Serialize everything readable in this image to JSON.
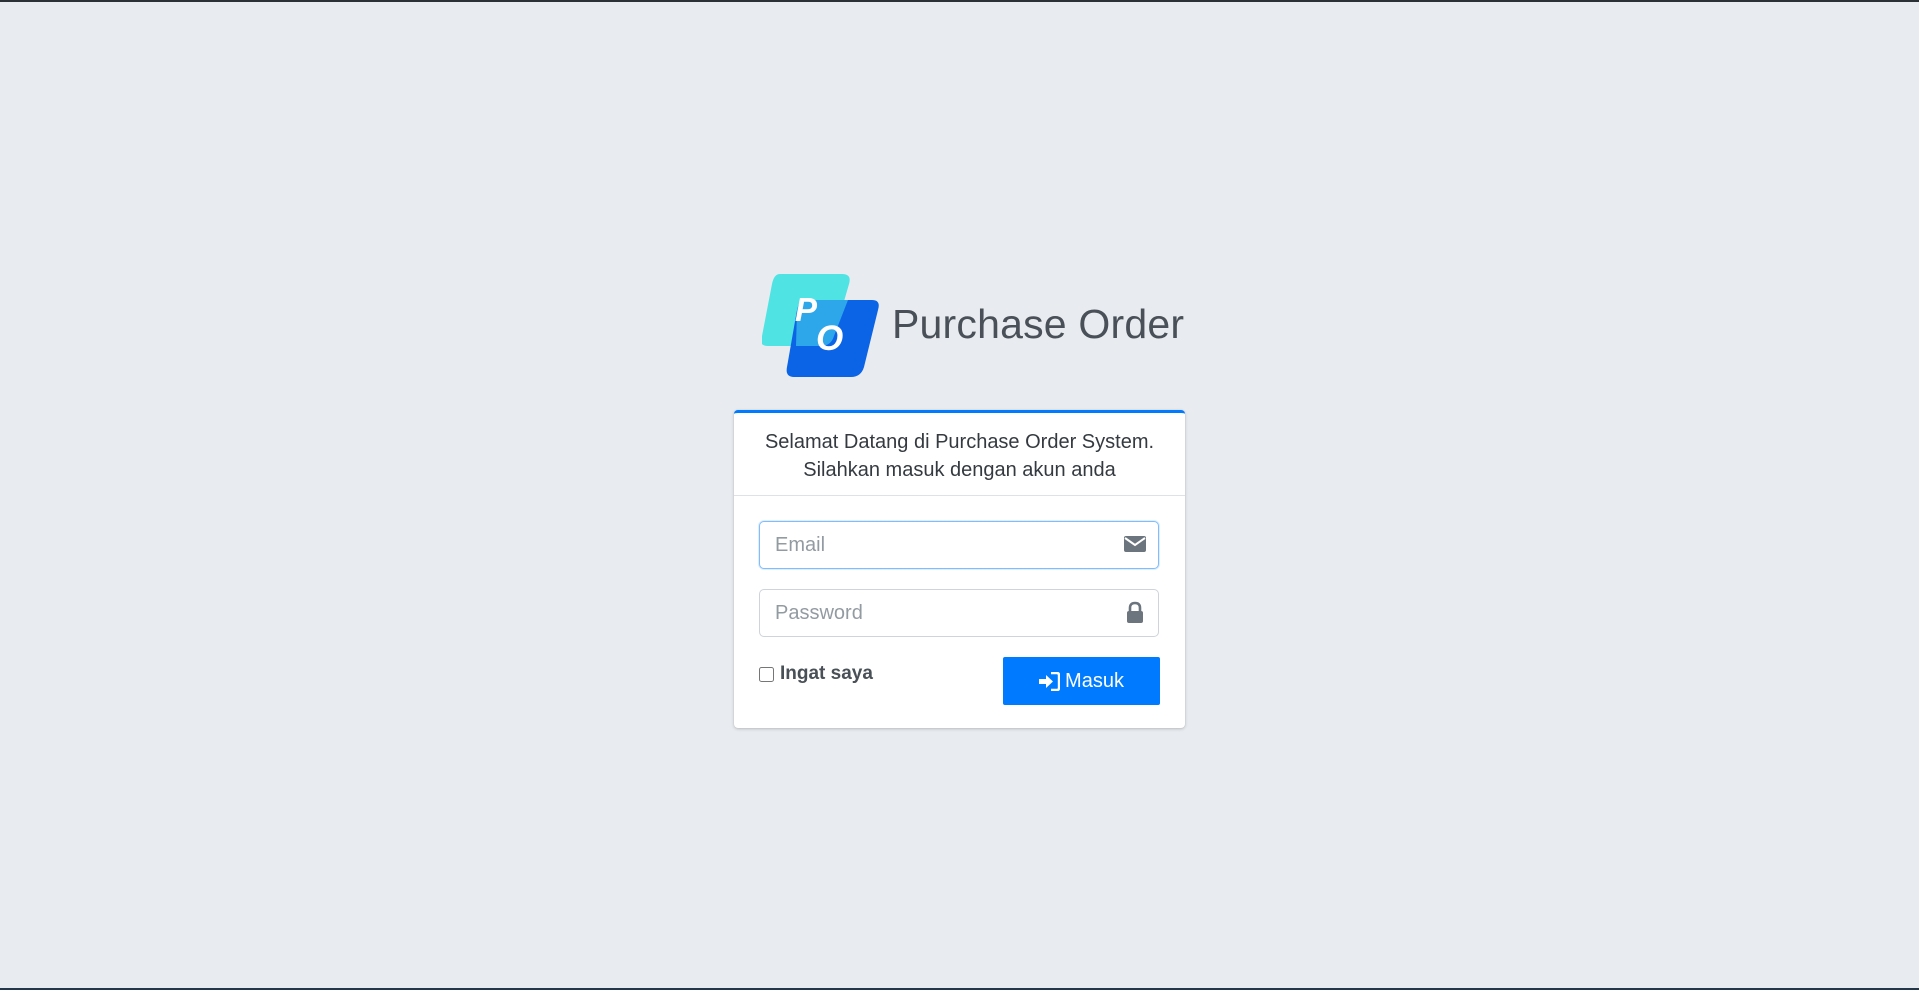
{
  "brand": {
    "logo_letters": [
      "P",
      "O"
    ],
    "title": "Purchase Order",
    "logo_colors": {
      "back": "#4fe3e3",
      "front": "#0b63e6"
    }
  },
  "card": {
    "welcome_line1": "Selamat Datang di Purchase Order System.",
    "welcome_line2": "Silahkan masuk dengan akun anda",
    "accent_color": "#007bff"
  },
  "form": {
    "email": {
      "placeholder": "Email",
      "value": "",
      "icon": "envelope-icon"
    },
    "password": {
      "placeholder": "Password",
      "value": "",
      "icon": "lock-icon"
    },
    "remember_label": "Ingat saya",
    "remember_checked": false,
    "submit_label": "Masuk",
    "submit_icon": "sign-in-icon"
  }
}
